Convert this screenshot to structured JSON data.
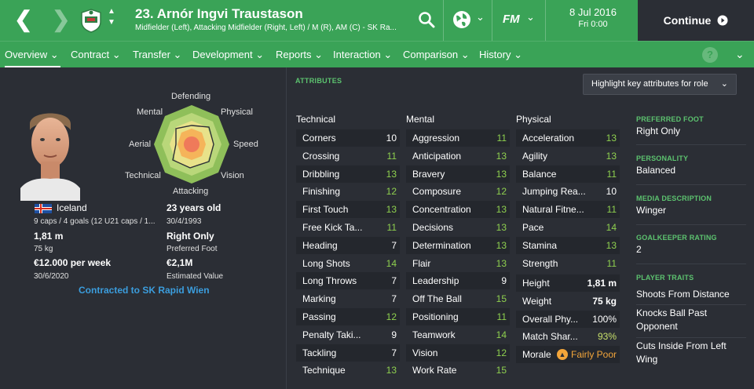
{
  "header": {
    "player_title": "23. Arnór Ingvi Traustason",
    "player_subtitle": "Midfielder (Left), Attacking Midfielder (Right, Left) / M (R), AM (C) - SK Ra...",
    "fm_label": "FM",
    "date": "8 Jul 2016",
    "time": "Fri 0:00",
    "continue_label": "Continue"
  },
  "tabs": [
    "Overview",
    "Contract",
    "Transfer",
    "Development",
    "Reports",
    "Interaction",
    "Comparison",
    "History"
  ],
  "help_label": "?",
  "profile": {
    "nationality": "Iceland",
    "caps": "9 caps / 4 goals (12 U21 caps / 1...",
    "height": "1,81 m",
    "weight": "75 kg",
    "wage": "€12.000 per week",
    "contract_end": "30/6/2020",
    "age": "23 years old",
    "dob": "30/4/1993",
    "preferred_foot": "Right Only",
    "preferred_foot_label": "Preferred Foot",
    "value": "€2,1M",
    "value_label": "Estimated Value",
    "contracted": "Contracted to SK Rapid Wien"
  },
  "radar": {
    "labels": {
      "defending": "Defending",
      "physical": "Physical",
      "speed": "Speed",
      "vision": "Vision",
      "attacking": "Attacking",
      "technical": "Technical",
      "aerial": "Aerial",
      "mental": "Mental"
    }
  },
  "attributes": {
    "title": "ATTRIBUTES",
    "highlight_label": "Highlight key attributes for role",
    "technical_head": "Technical",
    "mental_head": "Mental",
    "physical_head": "Physical",
    "technical": [
      {
        "name": "Corners",
        "value": "10"
      },
      {
        "name": "Crossing",
        "value": "11"
      },
      {
        "name": "Dribbling",
        "value": "13"
      },
      {
        "name": "Finishing",
        "value": "12"
      },
      {
        "name": "First Touch",
        "value": "13"
      },
      {
        "name": "Free Kick Ta...",
        "value": "11"
      },
      {
        "name": "Heading",
        "value": "7"
      },
      {
        "name": "Long Shots",
        "value": "14"
      },
      {
        "name": "Long Throws",
        "value": "7"
      },
      {
        "name": "Marking",
        "value": "7"
      },
      {
        "name": "Passing",
        "value": "12"
      },
      {
        "name": "Penalty Taki...",
        "value": "9"
      },
      {
        "name": "Tackling",
        "value": "7"
      },
      {
        "name": "Technique",
        "value": "13"
      }
    ],
    "mental": [
      {
        "name": "Aggression",
        "value": "11"
      },
      {
        "name": "Anticipation",
        "value": "13"
      },
      {
        "name": "Bravery",
        "value": "13"
      },
      {
        "name": "Composure",
        "value": "12"
      },
      {
        "name": "Concentration",
        "value": "13"
      },
      {
        "name": "Decisions",
        "value": "13"
      },
      {
        "name": "Determination",
        "value": "13"
      },
      {
        "name": "Flair",
        "value": "13"
      },
      {
        "name": "Leadership",
        "value": "9"
      },
      {
        "name": "Off The Ball",
        "value": "15"
      },
      {
        "name": "Positioning",
        "value": "11"
      },
      {
        "name": "Teamwork",
        "value": "14"
      },
      {
        "name": "Vision",
        "value": "12"
      },
      {
        "name": "Work Rate",
        "value": "15"
      }
    ],
    "physical": [
      {
        "name": "Acceleration",
        "value": "13"
      },
      {
        "name": "Agility",
        "value": "13"
      },
      {
        "name": "Balance",
        "value": "11"
      },
      {
        "name": "Jumping Rea...",
        "value": "10"
      },
      {
        "name": "Natural Fitne...",
        "value": "11"
      },
      {
        "name": "Pace",
        "value": "14"
      },
      {
        "name": "Stamina",
        "value": "13"
      },
      {
        "name": "Strength",
        "value": "11"
      }
    ],
    "condition": [
      {
        "name": "Height",
        "value": "1,81 m"
      },
      {
        "name": "Weight",
        "value": "75 kg"
      },
      {
        "name": "Overall Phy...",
        "value": "100%"
      },
      {
        "name": "Match Shar...",
        "value": "93%"
      },
      {
        "name": "Morale",
        "value": "Fairly Poor"
      }
    ]
  },
  "side": {
    "preferred_foot_label": "PREFERRED FOOT",
    "preferred_foot": "Right Only",
    "personality_label": "PERSONALITY",
    "personality": "Balanced",
    "media_label": "MEDIA DESCRIPTION",
    "media": "Winger",
    "gk_label": "GOALKEEPER RATING",
    "gk": "2",
    "traits_label": "PLAYER TRAITS",
    "traits": [
      "Shoots From Distance",
      "Knocks Ball Past Opponent",
      "Cuts Inside From Left Wing"
    ]
  },
  "colors": {
    "accent": "#3aa357",
    "background": "#2b2e35",
    "value_green": "#8fd14f",
    "link_blue": "#3b9ddd",
    "morale_orange": "#f2a53a"
  }
}
